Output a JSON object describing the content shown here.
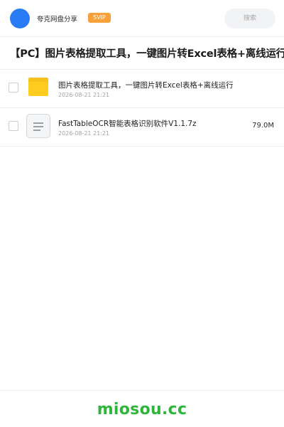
{
  "header": {
    "brand_name": "夸克网盘分享",
    "badge": "SVIP",
    "search_placeholder": "搜索"
  },
  "title": "【PC】图片表格提取工具，一键图片转Excel表格+离线运行",
  "files": [
    {
      "name": "图片表格提取工具，一键图片转Excel表格+离线运行",
      "date": "2026-08-21 21:21",
      "size": "",
      "icon": "folder-icon"
    },
    {
      "name": "FastTableOCR智能表格识别软件V1.1.7z",
      "date": "2026-08-21 21:21",
      "size": "79.0M",
      "icon": "document-icon"
    }
  ],
  "footer": {
    "watermark": "miosou.cc"
  },
  "colors": {
    "avatar": "#2a7cf6",
    "badge": "#f7a13b",
    "folder": "#ffcc1f",
    "watermark": "#2fb43c"
  }
}
